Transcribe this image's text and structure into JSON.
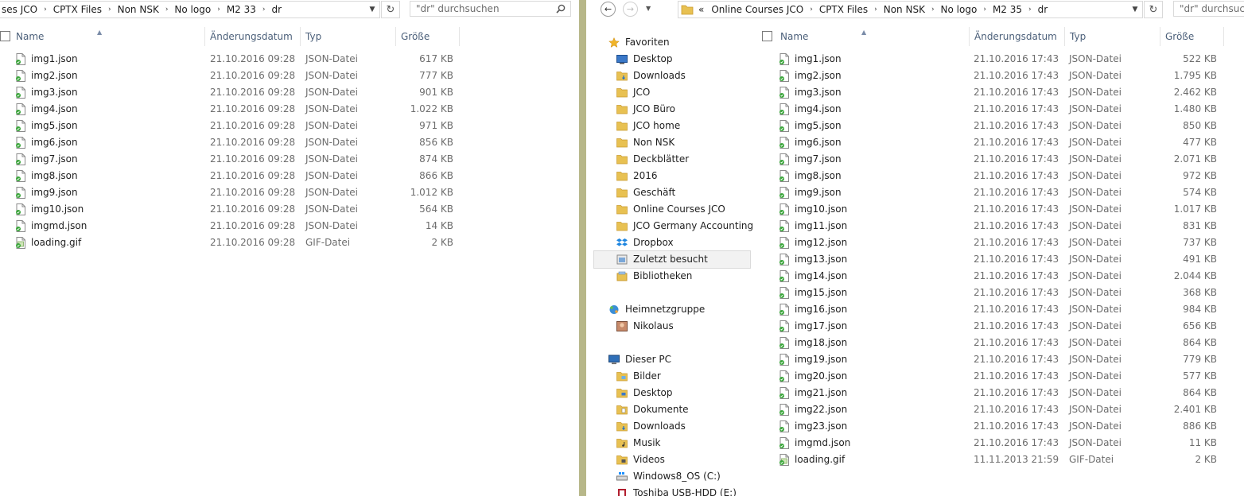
{
  "left": {
    "breadcrumb": [
      "ses JCO",
      "CPTX Files",
      "Non NSK",
      "No logo",
      "M2 33",
      "dr"
    ],
    "search_placeholder": "\"dr\" durchsuchen",
    "columns": {
      "name": "Name",
      "date": "Änderungsdatum",
      "type": "Typ",
      "size": "Größe"
    },
    "files": [
      {
        "name": "img1.json",
        "date": "21.10.2016 09:28",
        "type": "JSON-Datei",
        "size": "617 KB"
      },
      {
        "name": "img2.json",
        "date": "21.10.2016 09:28",
        "type": "JSON-Datei",
        "size": "777 KB"
      },
      {
        "name": "img3.json",
        "date": "21.10.2016 09:28",
        "type": "JSON-Datei",
        "size": "901 KB"
      },
      {
        "name": "img4.json",
        "date": "21.10.2016 09:28",
        "type": "JSON-Datei",
        "size": "1.022 KB"
      },
      {
        "name": "img5.json",
        "date": "21.10.2016 09:28",
        "type": "JSON-Datei",
        "size": "971 KB"
      },
      {
        "name": "img6.json",
        "date": "21.10.2016 09:28",
        "type": "JSON-Datei",
        "size": "856 KB"
      },
      {
        "name": "img7.json",
        "date": "21.10.2016 09:28",
        "type": "JSON-Datei",
        "size": "874 KB"
      },
      {
        "name": "img8.json",
        "date": "21.10.2016 09:28",
        "type": "JSON-Datei",
        "size": "866 KB"
      },
      {
        "name": "img9.json",
        "date": "21.10.2016 09:28",
        "type": "JSON-Datei",
        "size": "1.012 KB"
      },
      {
        "name": "img10.json",
        "date": "21.10.2016 09:28",
        "type": "JSON-Datei",
        "size": "564 KB"
      },
      {
        "name": "imgmd.json",
        "date": "21.10.2016 09:28",
        "type": "JSON-Datei",
        "size": "14 KB"
      },
      {
        "name": "loading.gif",
        "date": "21.10.2016 09:28",
        "type": "GIF-Datei",
        "size": "2 KB"
      }
    ]
  },
  "right": {
    "breadcrumb_prefix": "«",
    "breadcrumb": [
      "Online Courses JCO",
      "CPTX Files",
      "Non NSK",
      "No logo",
      "M2 35",
      "dr"
    ],
    "search_placeholder": "\"dr\" durchsuchen",
    "columns": {
      "name": "Name",
      "date": "Änderungsdatum",
      "type": "Typ",
      "size": "Größe"
    },
    "nav": [
      {
        "label": "Favoriten",
        "icon": "star-icon",
        "level": 0
      },
      {
        "label": "Desktop",
        "icon": "desktop-icon",
        "level": 1
      },
      {
        "label": "Downloads",
        "icon": "downloads-folder-icon",
        "level": 1
      },
      {
        "label": "JCO",
        "icon": "folder-icon",
        "level": 1
      },
      {
        "label": "JCO Büro",
        "icon": "folder-icon",
        "level": 1
      },
      {
        "label": "JCO home",
        "icon": "folder-icon",
        "level": 1
      },
      {
        "label": "Non NSK",
        "icon": "folder-icon",
        "level": 1
      },
      {
        "label": "Deckblätter",
        "icon": "folder-icon",
        "level": 1
      },
      {
        "label": "2016",
        "icon": "folder-icon",
        "level": 1
      },
      {
        "label": "Geschäft",
        "icon": "folder-icon",
        "level": 1
      },
      {
        "label": "Online Courses JCO",
        "icon": "folder-icon",
        "level": 1
      },
      {
        "label": "JCO Germany Accounting",
        "icon": "folder-icon",
        "level": 1
      },
      {
        "label": "Dropbox",
        "icon": "dropbox-icon",
        "level": 1
      },
      {
        "label": "Zuletzt besucht",
        "icon": "recent-places-icon",
        "level": 1,
        "selected": true
      },
      {
        "label": "Bibliotheken",
        "icon": "libraries-icon",
        "level": 1
      },
      {
        "label": "",
        "icon": "",
        "level": -1
      },
      {
        "label": "Heimnetzgruppe",
        "icon": "homegroup-icon",
        "level": 0
      },
      {
        "label": "Nikolaus",
        "icon": "user-avatar-icon",
        "level": 1
      },
      {
        "label": "",
        "icon": "",
        "level": -1
      },
      {
        "label": "Dieser PC",
        "icon": "computer-icon",
        "level": 0
      },
      {
        "label": "Bilder",
        "icon": "pictures-folder-icon",
        "level": 1
      },
      {
        "label": "Desktop",
        "icon": "desktop-folder-icon",
        "level": 1
      },
      {
        "label": "Dokumente",
        "icon": "documents-folder-icon",
        "level": 1
      },
      {
        "label": "Downloads",
        "icon": "downloads-folder-icon",
        "level": 1
      },
      {
        "label": "Musik",
        "icon": "music-folder-icon",
        "level": 1
      },
      {
        "label": "Videos",
        "icon": "videos-folder-icon",
        "level": 1
      },
      {
        "label": "Windows8_OS (C:)",
        "icon": "windows-drive-icon",
        "level": 1
      },
      {
        "label": "Toshiba USB-HDD (E:)",
        "icon": "usb-drive-icon",
        "level": 1
      }
    ],
    "files": [
      {
        "name": "img1.json",
        "date": "21.10.2016 17:43",
        "type": "JSON-Datei",
        "size": "522 KB"
      },
      {
        "name": "img2.json",
        "date": "21.10.2016 17:43",
        "type": "JSON-Datei",
        "size": "1.795 KB"
      },
      {
        "name": "img3.json",
        "date": "21.10.2016 17:43",
        "type": "JSON-Datei",
        "size": "2.462 KB"
      },
      {
        "name": "img4.json",
        "date": "21.10.2016 17:43",
        "type": "JSON-Datei",
        "size": "1.480 KB"
      },
      {
        "name": "img5.json",
        "date": "21.10.2016 17:43",
        "type": "JSON-Datei",
        "size": "850 KB"
      },
      {
        "name": "img6.json",
        "date": "21.10.2016 17:43",
        "type": "JSON-Datei",
        "size": "477 KB"
      },
      {
        "name": "img7.json",
        "date": "21.10.2016 17:43",
        "type": "JSON-Datei",
        "size": "2.071 KB"
      },
      {
        "name": "img8.json",
        "date": "21.10.2016 17:43",
        "type": "JSON-Datei",
        "size": "972 KB"
      },
      {
        "name": "img9.json",
        "date": "21.10.2016 17:43",
        "type": "JSON-Datei",
        "size": "574 KB"
      },
      {
        "name": "img10.json",
        "date": "21.10.2016 17:43",
        "type": "JSON-Datei",
        "size": "1.017 KB"
      },
      {
        "name": "img11.json",
        "date": "21.10.2016 17:43",
        "type": "JSON-Datei",
        "size": "831 KB"
      },
      {
        "name": "img12.json",
        "date": "21.10.2016 17:43",
        "type": "JSON-Datei",
        "size": "737 KB"
      },
      {
        "name": "img13.json",
        "date": "21.10.2016 17:43",
        "type": "JSON-Datei",
        "size": "491 KB"
      },
      {
        "name": "img14.json",
        "date": "21.10.2016 17:43",
        "type": "JSON-Datei",
        "size": "2.044 KB"
      },
      {
        "name": "img15.json",
        "date": "21.10.2016 17:43",
        "type": "JSON-Datei",
        "size": "368 KB"
      },
      {
        "name": "img16.json",
        "date": "21.10.2016 17:43",
        "type": "JSON-Datei",
        "size": "984 KB"
      },
      {
        "name": "img17.json",
        "date": "21.10.2016 17:43",
        "type": "JSON-Datei",
        "size": "656 KB"
      },
      {
        "name": "img18.json",
        "date": "21.10.2016 17:43",
        "type": "JSON-Datei",
        "size": "864 KB"
      },
      {
        "name": "img19.json",
        "date": "21.10.2016 17:43",
        "type": "JSON-Datei",
        "size": "779 KB"
      },
      {
        "name": "img20.json",
        "date": "21.10.2016 17:43",
        "type": "JSON-Datei",
        "size": "577 KB"
      },
      {
        "name": "img21.json",
        "date": "21.10.2016 17:43",
        "type": "JSON-Datei",
        "size": "864 KB"
      },
      {
        "name": "img22.json",
        "date": "21.10.2016 17:43",
        "type": "JSON-Datei",
        "size": "2.401 KB"
      },
      {
        "name": "img23.json",
        "date": "21.10.2016 17:43",
        "type": "JSON-Datei",
        "size": "886 KB"
      },
      {
        "name": "imgmd.json",
        "date": "21.10.2016 17:43",
        "type": "JSON-Datei",
        "size": "11 KB"
      },
      {
        "name": "loading.gif",
        "date": "11.11.2013 21:59",
        "type": "GIF-Datei",
        "size": "2 KB"
      }
    ]
  },
  "colors": {
    "divider": "#b7b789",
    "header_text": "#4c607a",
    "meta_text": "#6d6d6d",
    "folder": "#e8c152"
  }
}
